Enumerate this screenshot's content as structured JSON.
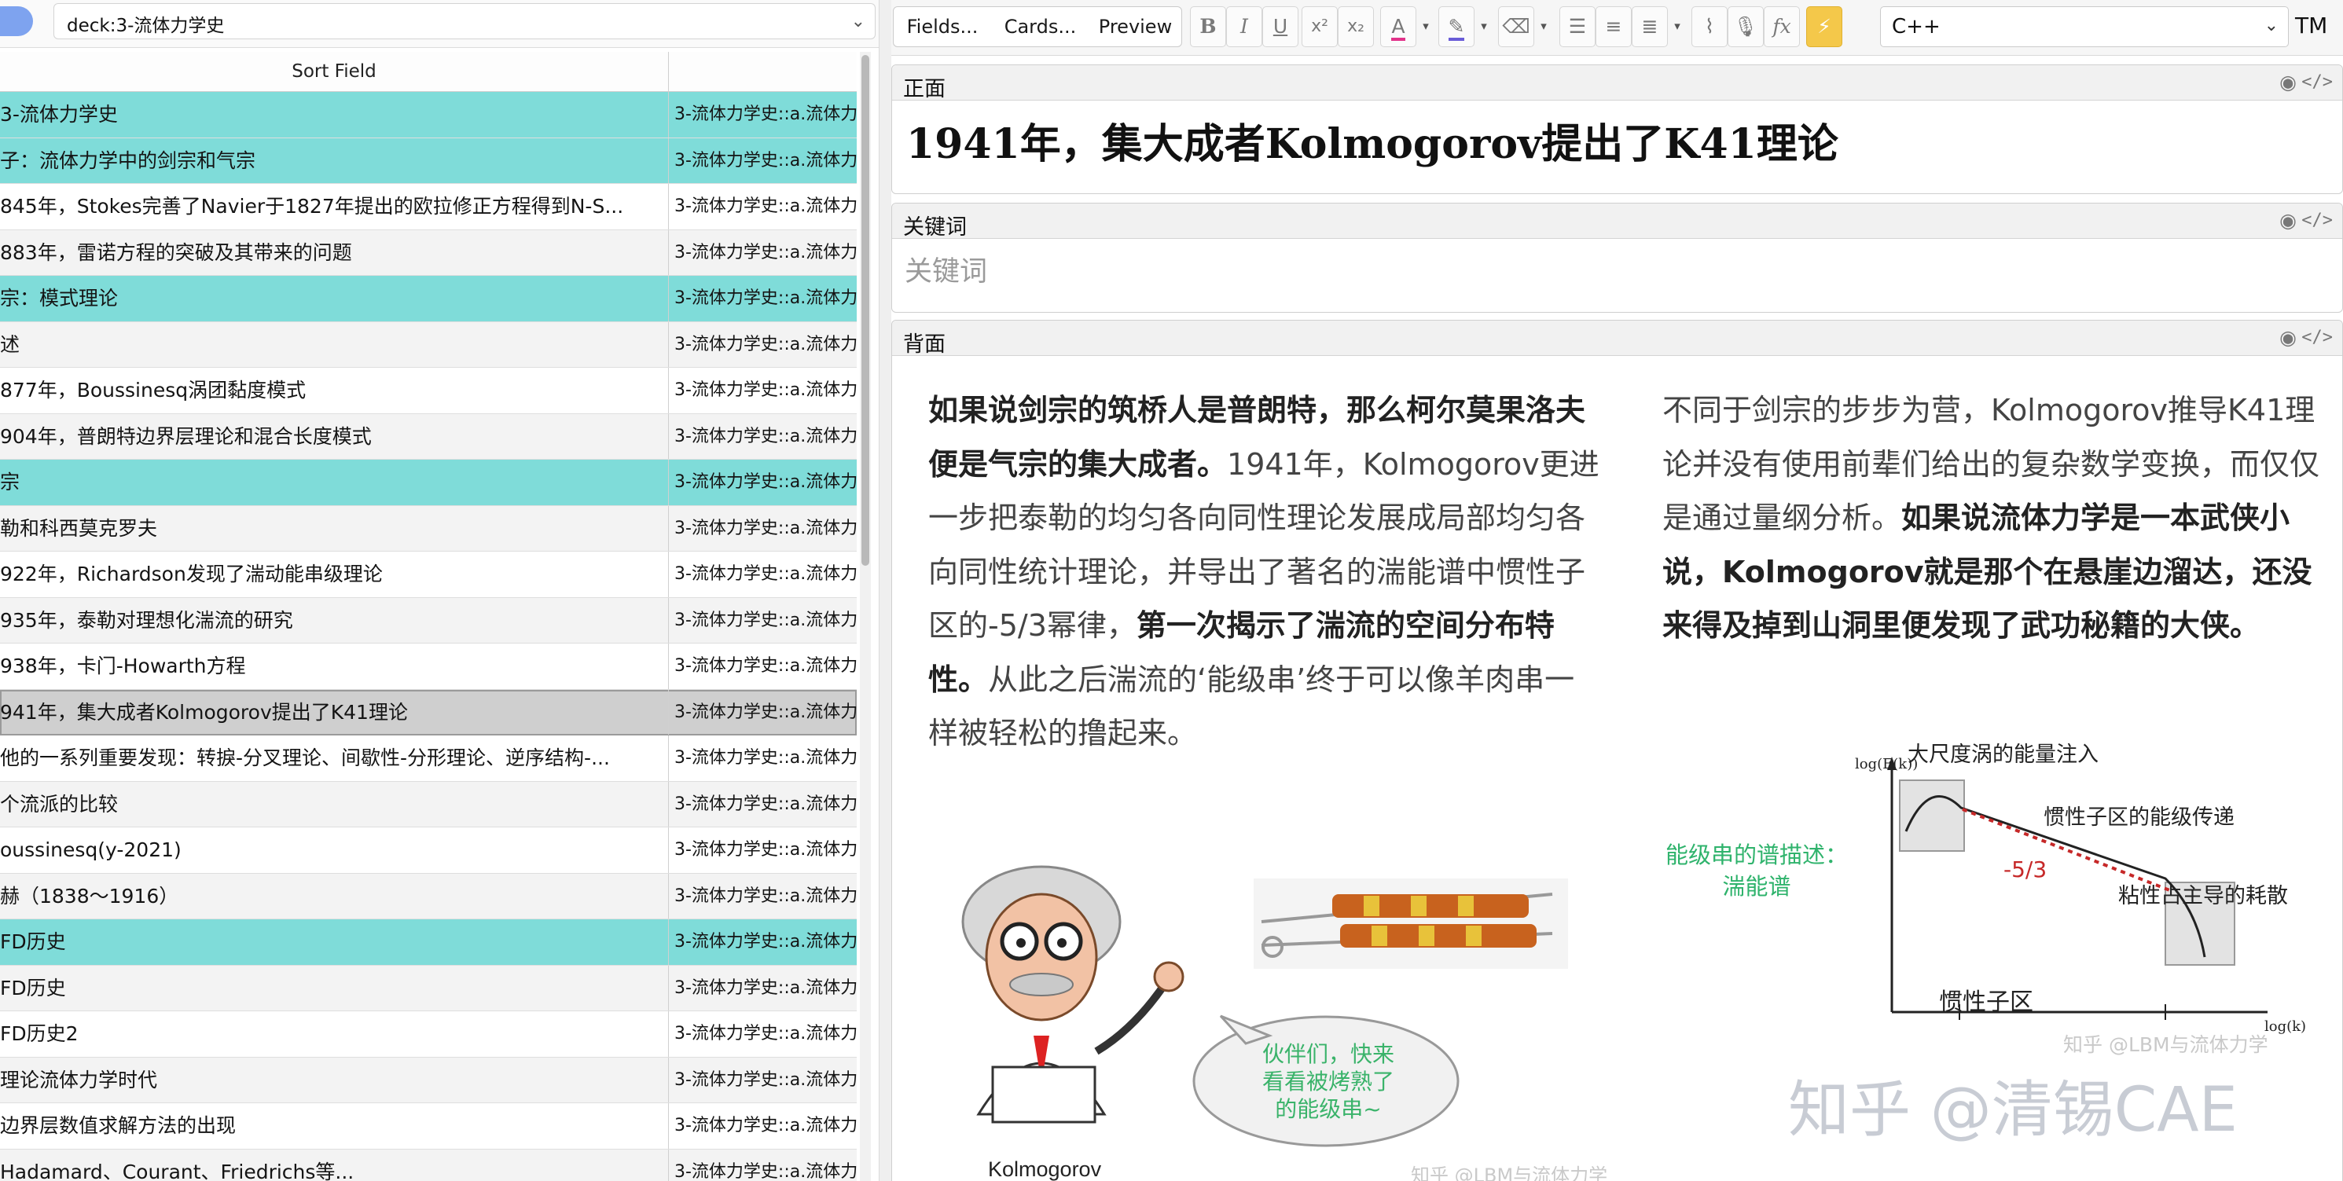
{
  "search": {
    "value": "deck:3-流体力学史"
  },
  "table": {
    "columns": [
      "Sort Field"
    ],
    "rows": [
      {
        "sort": "3-流体力学史",
        "deck": "3-流体力学史::a.流体力"
      },
      {
        "sort": "子：流体力学中的剑宗和气宗",
        "deck": "3-流体力学史::a.流体力"
      },
      {
        "sort": "845年，Stokes完善了Navier于1827年提出的欧拉修正方程得到N-S...",
        "deck": "3-流体力学史::a.流体力"
      },
      {
        "sort": "883年，雷诺方程的突破及其带来的问题",
        "deck": "3-流体力学史::a.流体力"
      },
      {
        "sort": "宗：模式理论",
        "deck": "3-流体力学史::a.流体力"
      },
      {
        "sort": "述",
        "deck": "3-流体力学史::a.流体力"
      },
      {
        "sort": "877年，Boussinesq涡团黏度模式",
        "deck": "3-流体力学史::a.流体力"
      },
      {
        "sort": "904年，普朗特边界层理论和混合长度模式",
        "deck": "3-流体力学史::a.流体力"
      },
      {
        "sort": "宗",
        "deck": "3-流体力学史::a.流体力"
      },
      {
        "sort": "勒和科西莫克罗夫",
        "deck": "3-流体力学史::a.流体力"
      },
      {
        "sort": "922年，Richardson发现了湍动能串级理论",
        "deck": "3-流体力学史::a.流体力"
      },
      {
        "sort": "935年，泰勒对理想化湍流的研究",
        "deck": "3-流体力学史::a.流体力"
      },
      {
        "sort": "938年，卡门-Howarth方程",
        "deck": "3-流体力学史::a.流体力"
      },
      {
        "sort": "941年，集大成者Kolmogorov提出了K41理论",
        "deck": "3-流体力学史::a.流体力"
      },
      {
        "sort": "他的一系列重要发现：转捩-分叉理论、间歇性-分形理论、逆序结构-...",
        "deck": "3-流体力学史::a.流体力"
      },
      {
        "sort": "个流派的比较",
        "deck": "3-流体力学史::a.流体力"
      },
      {
        "sort": "oussinesq(y-2021)",
        "deck": "3-流体力学史::a.流体力"
      },
      {
        "sort": "赫（1838～1916）",
        "deck": "3-流体力学史::a.流体力"
      },
      {
        "sort": "FD历史",
        "deck": "3-流体力学史::a.流体力"
      },
      {
        "sort": "FD历史",
        "deck": "3-流体力学史::a.流体力"
      },
      {
        "sort": "FD历史2",
        "deck": "3-流体力学史::a.流体力"
      },
      {
        "sort": "理论流体力学时代",
        "deck": "3-流体力学史::a.流体力"
      },
      {
        "sort": "边界层数值求解方法的出现",
        "deck": "3-流体力学史::a.流体力"
      },
      {
        "sort": "Hadamard、Courant、Friedrichs等...",
        "deck": "3-流体力学史::a.流体力"
      }
    ]
  },
  "toolbar": {
    "fields_label": "Fields...",
    "cards_label": "Cards...",
    "preview_label": "Preview",
    "lang_value": "C++",
    "tm_label": "TM"
  },
  "fields": {
    "front": {
      "name": "正面",
      "value": "1941年，集大成者Kolmogorov提出了K41理论"
    },
    "keywords": {
      "name": "关键词",
      "placeholder": "关键词"
    },
    "back": {
      "name": "背面",
      "left_para": {
        "bold1": "如果说剑宗的筑桥人是普朗特，那么柯尔莫果洛夫便是气宗的集大成者。",
        "text1": "1941年，Kolmogorov更进一步把泰勒的均匀各向同性理论发展成局部均匀各向同性统计理论，并导出了著名的湍能谱中惯性子区的-5/3幂律，",
        "bold2": "第一次揭示了湍流的空间分布特性。",
        "text2": "从此之后湍流的‘能级串’终于可以像羊肉串一样被轻松的撸起来。"
      },
      "right_para": {
        "text1": "不同于剑宗的步步为营，Kolmogorov推导K41理论并没有使用前辈们给出的复杂数学变换，而仅仅是通过量纲分析。",
        "bold1": "如果说流体力学是一本武侠小说，Kolmogorov就是那个在悬崖边溜达，还没来得及掉到山洞里便发现了武功秘籍的大侠。"
      },
      "cartoon": {
        "name_caption": "Kolmogorov",
        "bubble": [
          "伙伴们，快来",
          "看看被烤熟了",
          "的能级串~"
        ],
        "watermark": "知乎 @LBM与流体力学"
      },
      "spectrum": {
        "side_caption": [
          "能级串的谱描述：",
          "湍能谱"
        ],
        "ylabel": "log(E(k))",
        "xlabel": "log(k)",
        "slope_label": "-5/3",
        "labels": [
          "大尺度涡的能量注入",
          "惯性子区的能级传递",
          "粘性占主导的耗散",
          "惯性子区"
        ],
        "watermark": "知乎 @LBM与流体力学"
      },
      "big_watermark": "知乎 @清锡CAE"
    }
  },
  "colors": {
    "row_highlight": "#7fdcd9",
    "row_selected": "#cfcfcf",
    "spectrum_red": "#c62828",
    "caption_green": "#2fb36c"
  }
}
